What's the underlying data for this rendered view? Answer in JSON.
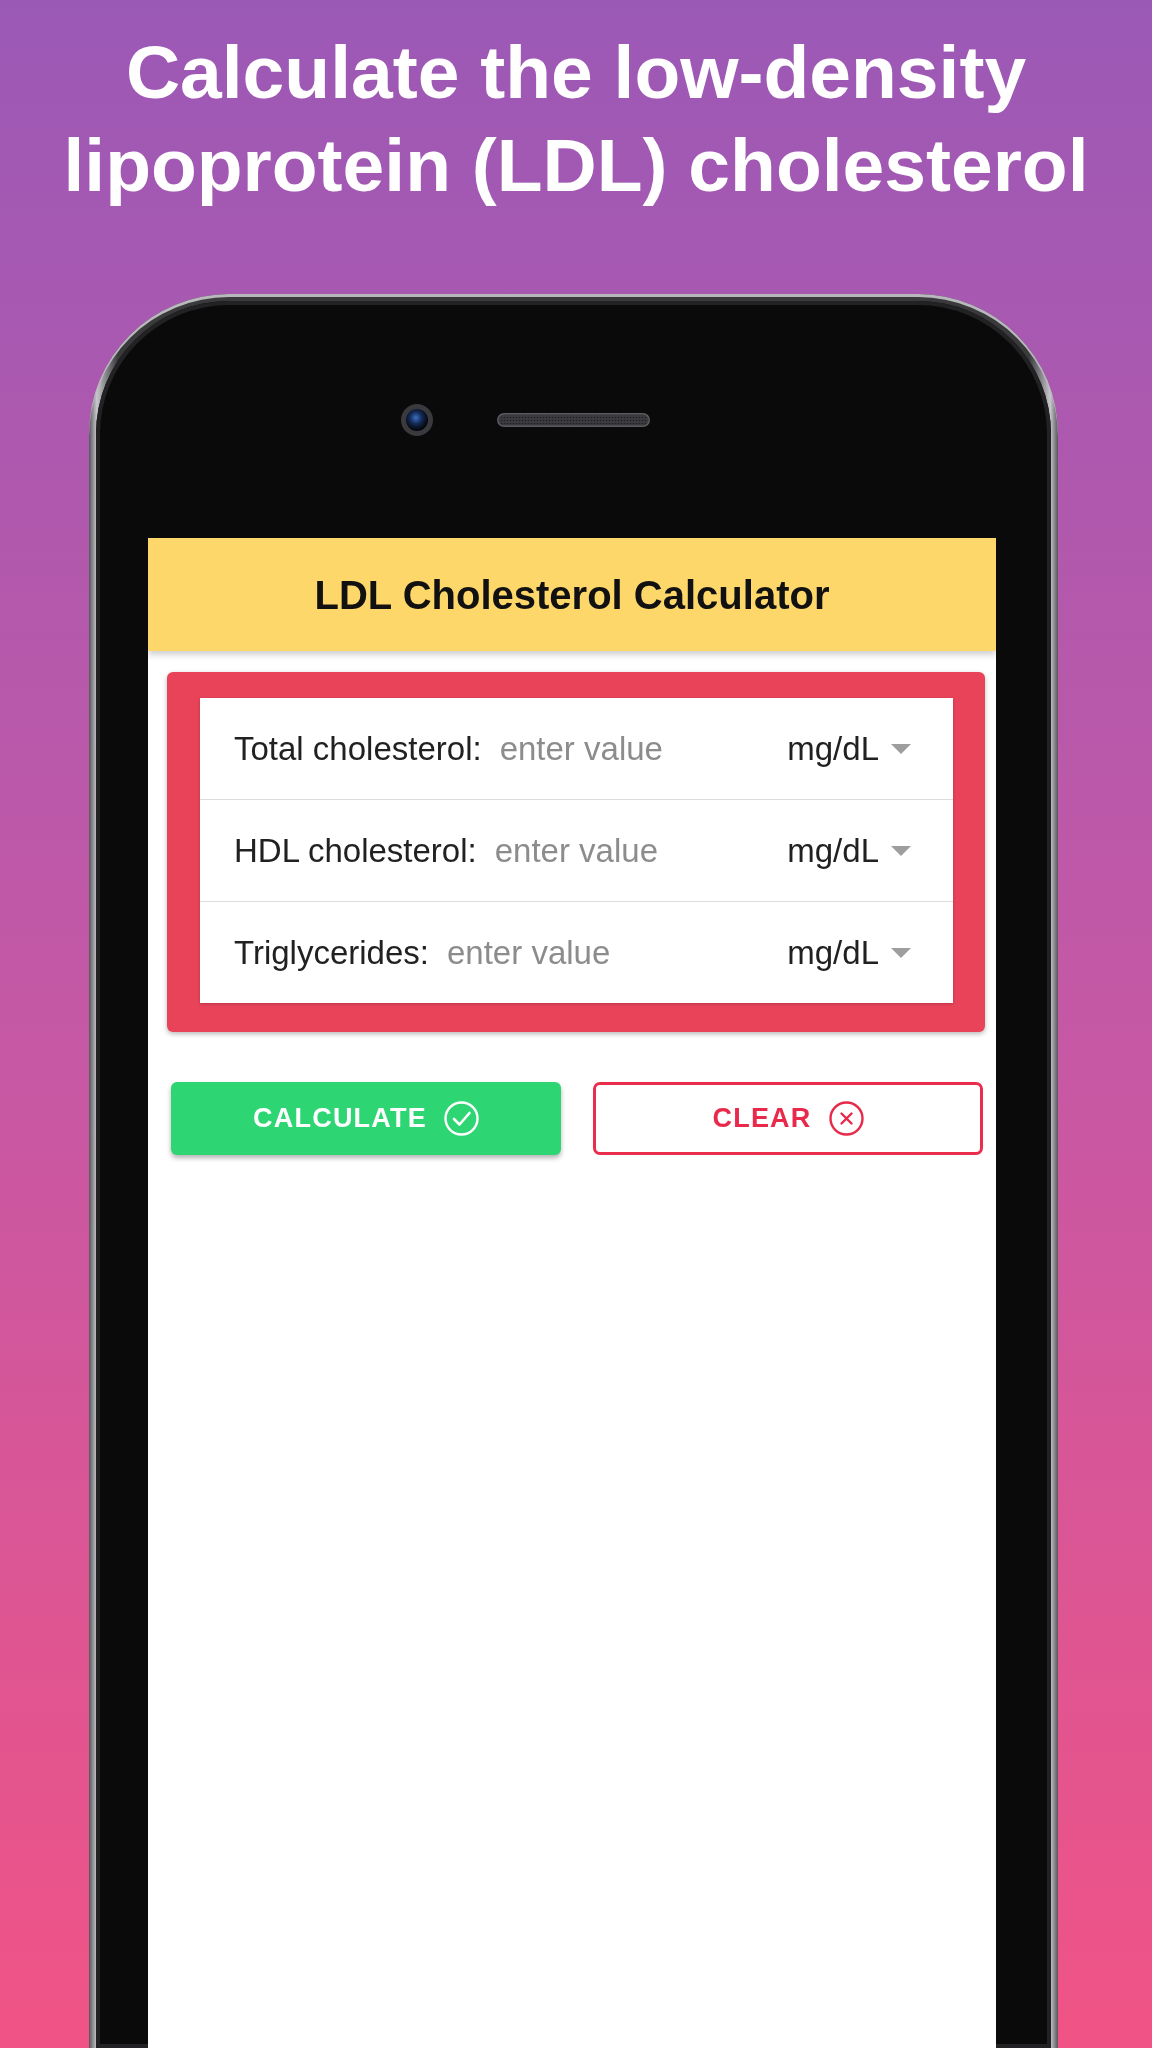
{
  "banner": {
    "title": "Calculate the low-density lipoprotein (LDL) cholesterol"
  },
  "app_bar": {
    "title": "LDL Cholesterol Calculator"
  },
  "inputs": [
    {
      "label": "Total cholesterol:",
      "placeholder": "enter value",
      "unit": "mg/dL"
    },
    {
      "label": "HDL cholesterol:",
      "placeholder": "enter value",
      "unit": "mg/dL"
    },
    {
      "label": "Triglycerides:",
      "placeholder": "enter value",
      "unit": "mg/dL"
    }
  ],
  "buttons": [
    {
      "kind": "filled",
      "label": "CALCULATE"
    },
    {
      "kind": "outlined",
      "label": "CLEAR"
    }
  ]
}
